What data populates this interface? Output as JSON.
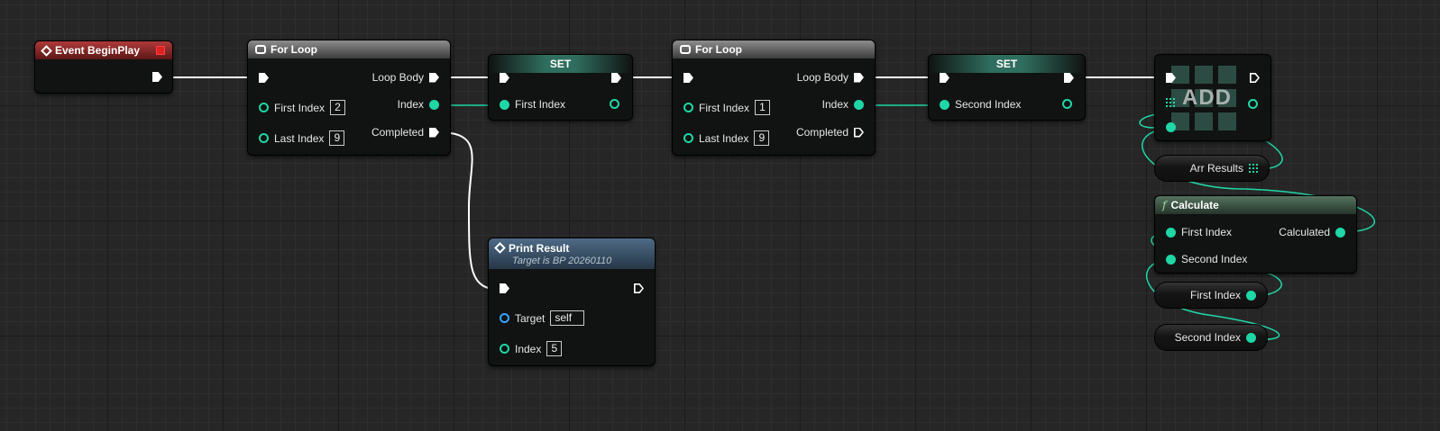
{
  "nodes": {
    "event_begin_play": {
      "title": "Event BeginPlay"
    },
    "for_loop_1": {
      "title": "For Loop",
      "loop_body": "Loop Body",
      "index": "Index",
      "completed": "Completed",
      "first_index_label": "First Index",
      "first_index_value": "2",
      "last_index_label": "Last Index",
      "last_index_value": "9"
    },
    "set_1": {
      "title": "SET",
      "var_label": "First Index"
    },
    "for_loop_2": {
      "title": "For Loop",
      "loop_body": "Loop Body",
      "index": "Index",
      "completed": "Completed",
      "first_index_label": "First Index",
      "first_index_value": "1",
      "last_index_label": "Last Index",
      "last_index_value": "9"
    },
    "set_2": {
      "title": "SET",
      "var_label": "Second Index"
    },
    "add": {
      "title": "ADD"
    },
    "arr_results": {
      "label": "Arr Results"
    },
    "calculate": {
      "title": "Calculate",
      "first_index": "First Index",
      "second_index": "Second Index",
      "calculated": "Calculated"
    },
    "get_first_index": {
      "label": "First Index"
    },
    "get_second_index": {
      "label": "Second Index"
    },
    "print_result": {
      "title": "Print Result",
      "subtitle": "Target is BP 20260110",
      "target_label": "Target",
      "target_value": "self",
      "index_label": "Index",
      "index_value": "5"
    }
  },
  "colors": {
    "exec_wire": "#ffffff",
    "data_wire": "#1fd7a6",
    "object_pin": "#37a3ff",
    "event_header": "#b13a3a",
    "set_header": "#2f6e5e",
    "func_header": "#55735f",
    "print_header": "#4e6b86"
  },
  "icons": {
    "event": "event-diamond-icon",
    "loop": "macro-loop-icon",
    "function": "function-f-icon",
    "array": "array-grid-icon",
    "stop": "breakpoint-stop-icon"
  }
}
